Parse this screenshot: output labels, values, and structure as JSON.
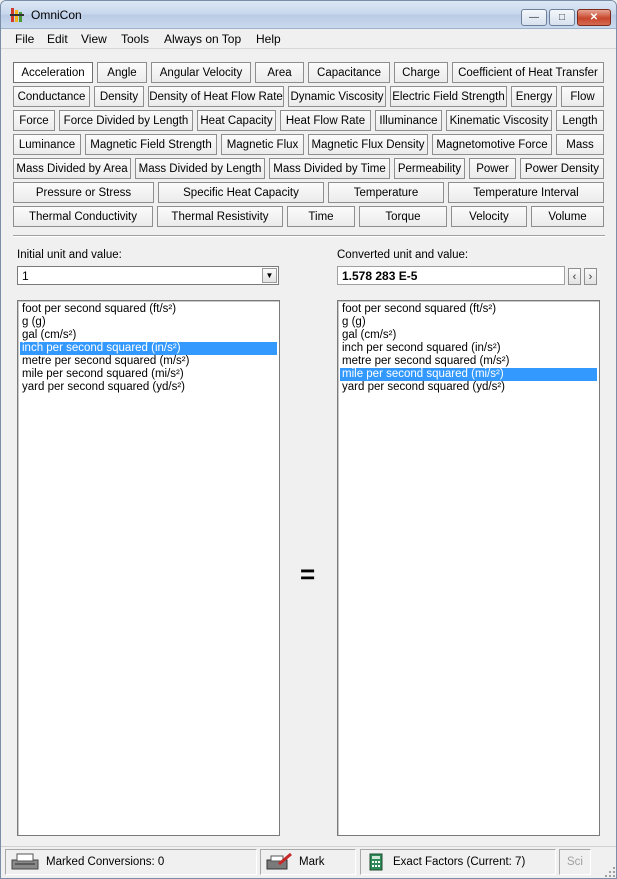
{
  "window": {
    "title": "OmniCon"
  },
  "menu": [
    "File",
    "Edit",
    "View",
    "Tools",
    "Always on Top",
    "Help"
  ],
  "quantities": [
    [
      "Acceleration",
      "Angle",
      "Angular Velocity",
      "Area",
      "Capacitance",
      "Charge",
      "Coefficient of Heat Transfer"
    ],
    [
      "Conductance",
      "Density",
      "Density of Heat Flow Rate",
      "Dynamic Viscosity",
      "Electric Field Strength",
      "Energy",
      "Flow"
    ],
    [
      "Force",
      "Force Divided by Length",
      "Heat Capacity",
      "Heat Flow Rate",
      "Illuminance",
      "Kinematic Viscosity",
      "Length"
    ],
    [
      "Luminance",
      "Magnetic Field Strength",
      "Magnetic Flux",
      "Magnetic Flux Density",
      "Magnetomotive Force",
      "Mass"
    ],
    [
      "Mass Divided by Area",
      "Mass Divided by Length",
      "Mass Divided by Time",
      "Permeability",
      "Power",
      "Power Density"
    ],
    [
      "Pressure or Stress",
      "Specific Heat Capacity",
      "Temperature",
      "Temperature Interval"
    ],
    [
      "Thermal Conductivity",
      "Thermal Resistivity",
      "Time",
      "Torque",
      "Velocity",
      "Volume"
    ]
  ],
  "active_quantity": "Acceleration",
  "initial": {
    "label": "Initial unit and value:",
    "value": "1",
    "units": [
      "foot per second squared (ft/s²)",
      "g (g)",
      "gal (cm/s²)",
      "inch per second squared (in/s²)",
      "metre per second squared (m/s²)",
      "mile per second squared (mi/s²)",
      "yard per second squared (yd/s²)"
    ],
    "selected_unit": "inch per second squared (in/s²)"
  },
  "converted": {
    "label": "Converted unit and value:",
    "value": "1.578 283 E-5",
    "units": [
      "foot per second squared (ft/s²)",
      "g (g)",
      "gal (cm/s²)",
      "inch per second squared (in/s²)",
      "metre per second squared (m/s²)",
      "mile per second squared (mi/s²)",
      "yard per second squared (yd/s²)"
    ],
    "selected_unit": "mile per second squared (mi/s²)"
  },
  "equals": "=",
  "status": {
    "marked": "Marked Conversions: 0",
    "mark": "Mark",
    "exact": "Exact Factors  (Current: 7)",
    "sci": "Sci"
  }
}
